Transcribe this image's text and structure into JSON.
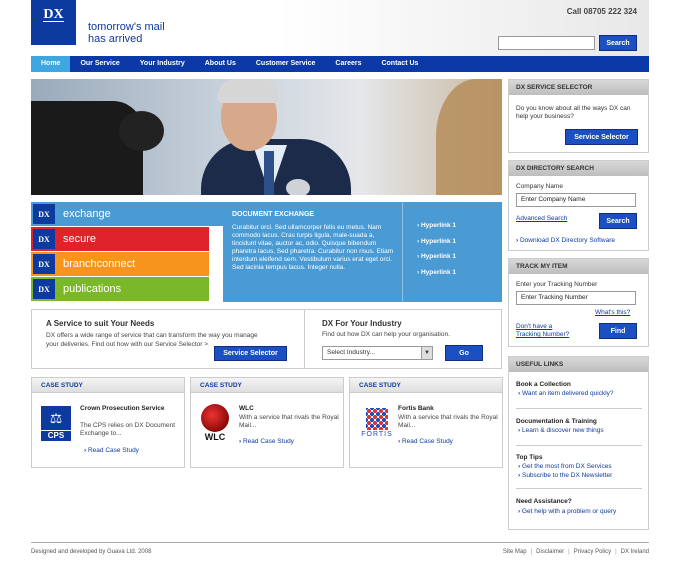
{
  "header": {
    "logo": "DX",
    "tagline_line1": "tomorrow's mail",
    "tagline_line2": "has arrived",
    "phone": "Call 08705 222 324",
    "search_button": "Search"
  },
  "nav": [
    "Home",
    "Our Service",
    "Your Industry",
    "About Us",
    "Customer Service",
    "Careers",
    "Contact Us"
  ],
  "services": [
    {
      "logo": "DX",
      "name": "exchange",
      "color": "#4a9ad3"
    },
    {
      "logo": "DX",
      "name": "secure",
      "color": "#e0222a"
    },
    {
      "logo": "DX",
      "name": "branchconnect",
      "color": "#f7941d"
    },
    {
      "logo": "DX",
      "name": "publications",
      "color": "#7ab829"
    }
  ],
  "document_exchange": {
    "title": "DOCUMENT EXCHANGE",
    "body": "Curabitur orci. Sed ullamcorper felis eu metus. Nam commodo lacus. Cras turpis ligula, male-suada a, tincidunt vitae, auctor ac, odio. Quisque bibendum pharetra lacus. Sed pharetra. Curabitur non risus. Etiam interdum eleifend sem. Vestibulum varius erat eget orci. Sed lacinia tempus lacus. Integer nulla."
  },
  "hyperlinks": [
    "Hyperlink 1",
    "Hyperlink 1",
    "Hyperlink 1",
    "Hyperlink 1"
  ],
  "suit_panel": {
    "title": "A Service to suit Your Needs",
    "text": "DX offers a wide range of service that can transform the way you manage your deliveries. Find out how with our Service Selector >",
    "button": "Service Selector"
  },
  "industry_panel": {
    "title": "DX For Your Industry",
    "text": "Find out how DX can help your organisation.",
    "select_value": "Select Industry...",
    "button": "Go"
  },
  "case_studies": [
    {
      "head": "CASE STUDY",
      "logo": "CPS",
      "title": "Crown Prosecution Service",
      "desc": "The CPS relies on DX Document Exchange to...",
      "link": "Read Case Study"
    },
    {
      "head": "CASE STUDY",
      "logo": "WLC",
      "title": "WLC",
      "desc": "With a service that rivals the Royal Mail...",
      "link": "Read Case Study"
    },
    {
      "head": "CASE STUDY",
      "logo": "FORTIS",
      "title": "Fortis Bank",
      "desc": "With a service that rivals the Royal Mail...",
      "link": "Read Case Study"
    }
  ],
  "sidebar": {
    "selector": {
      "head": "DX SERVICE SELECTOR",
      "text": "Do you know about all the ways DX can help your business?",
      "button": "Service Selector"
    },
    "directory": {
      "head": "DX DIRECTORY SEARCH",
      "label": "Company Name",
      "value": "Enter Company Name",
      "advanced": "Advanced Search",
      "button": "Search",
      "download": "Download DX Directory Software"
    },
    "track": {
      "head": "TRACK MY ITEM",
      "label": "Enter your Tracking Number",
      "value": "Enter Tracking Number",
      "whats_this": "What's this?",
      "no_number_1": "Don't have a",
      "no_number_2": "Tracking Number?",
      "button": "Find"
    },
    "useful": {
      "head": "USEFUL LINKS",
      "groups": [
        {
          "title": "Book a Collection",
          "links": [
            "Want an item delivered quickly?"
          ]
        },
        {
          "title": "Documentation & Training",
          "links": [
            "Learn & discover new things"
          ]
        },
        {
          "title": "Top Tips",
          "links": [
            "Get the most from DX Services",
            "Subscribe to the DX Newsletter"
          ]
        },
        {
          "title": "Need Assistance?",
          "links": [
            "Get help with a problem or query"
          ]
        }
      ]
    }
  },
  "footer": {
    "credit": "Designed and developed by Guava Ltd. 2008",
    "links": [
      "Site Map",
      "Disclaimer",
      "Privacy Policy",
      "DX Ireland"
    ]
  }
}
